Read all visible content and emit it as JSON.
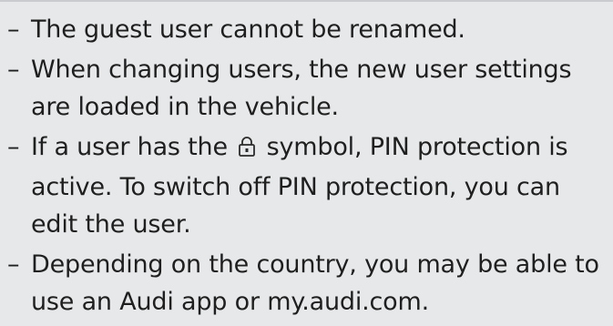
{
  "notes": {
    "items": [
      {
        "dash": "–",
        "text": "The guest user cannot be renamed."
      },
      {
        "dash": "–",
        "text": "When changing users, the new user settings are loaded in the vehicle."
      },
      {
        "dash": "–",
        "text_before": "If a user has the",
        "icon": "lock-icon",
        "text_after": "symbol, PIN protection is active. To switch off PIN protection, you can edit the user."
      },
      {
        "dash": "–",
        "text": "Depending on the country, you may be able to use an Audi app or my.audi.com."
      }
    ]
  }
}
